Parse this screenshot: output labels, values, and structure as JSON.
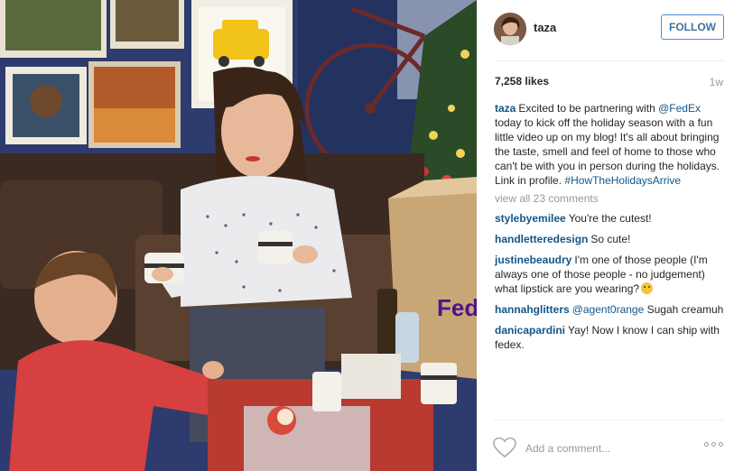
{
  "post": {
    "username": "taza",
    "follow_label": "FOLLOW",
    "likes": "7,258 likes",
    "time": "1w",
    "caption": {
      "username": "taza",
      "text_1": "Excited to be partnering with",
      "mention": "@FedEx",
      "text_2": "today to kick off the holiday season with a fun little video up on my blog! It's all about bringing the taste, smell and feel of home to those who can't be with you in person during the holidays. Link in profile.",
      "hashtag": "#HowTheHolidaysArrive"
    },
    "view_all": "view all 23 comments",
    "comments": [
      {
        "user": "stylebyemilee",
        "text": "You're the cutest!"
      },
      {
        "user": "handletteredesign",
        "text": "So cute!"
      },
      {
        "user": "justinebeaudry",
        "text": "I'm one of those people (I'm always one of those people - no judgement) what lipstick are you wearing?"
      },
      {
        "user": "hannahglitters",
        "mention": "@agent0range",
        "text": "Sugah creamuh"
      },
      {
        "user": "danicapardini",
        "text": "Yay! Now I know I can ship with fedex."
      }
    ],
    "add_comment_placeholder": "Add a comment...",
    "photo_box_text": "FedEx"
  },
  "icons": {
    "like": "heart-icon",
    "more": "more-options-icon",
    "emoji": "grinning-emoji-icon"
  },
  "colors": {
    "link": "#125688",
    "follow_border": "#4a90d9",
    "follow_text": "#3f729b",
    "muted": "#999999",
    "fedex_purple": "#4d148c"
  }
}
